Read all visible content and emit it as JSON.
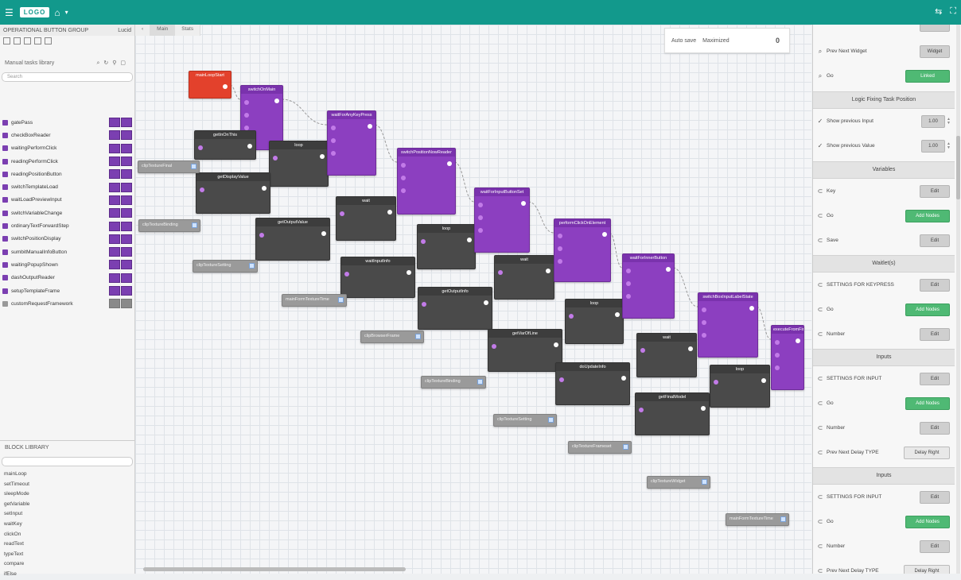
{
  "topbar": {
    "brand": "LOGO",
    "menu_icon": "menu-icon",
    "home_icon": "home-icon"
  },
  "left": {
    "header": "OPERATIONAL BUTTON GROUP",
    "header_right": "Lucid",
    "section": "Manual tasks library",
    "search_placeholder": "Search",
    "items": [
      {
        "label": "gatePass"
      },
      {
        "label": "checkBoxReader"
      },
      {
        "label": "waitingPerformClick"
      },
      {
        "label": "readingPerformClick"
      },
      {
        "label": "readingPositionButton"
      },
      {
        "label": "switchTemplateLoad"
      },
      {
        "label": "waitLoadPreviewInput"
      },
      {
        "label": "switchVariableChange"
      },
      {
        "label": "ordinaryTextForwardStep"
      },
      {
        "label": "switchPositionDisplay"
      },
      {
        "label": "sumbitManualInfoButton"
      },
      {
        "label": "waitingPopupShown"
      },
      {
        "label": "dashOutputReader"
      },
      {
        "label": "setupTemplateFrame"
      },
      {
        "label": "customRequestFramework"
      }
    ],
    "library_title": "BLOCK LIBRARY",
    "library_search": "",
    "library": [
      "mainLoop",
      "setTimeout",
      "sleepMode",
      "getVariable",
      "setInput",
      "waitKey",
      "clickOn",
      "readText",
      "typeText",
      "compare",
      "ifElse"
    ]
  },
  "canvas": {
    "tabs": [
      "‹",
      "Main",
      "Stats"
    ],
    "info": {
      "a": "Auto save",
      "b": "Maximized",
      "count": "0"
    },
    "nodes": [
      {
        "title": "mainLoopStart",
        "c": "red"
      },
      {
        "title": "switchOnMain",
        "c": "purple"
      },
      {
        "title": "getInOnThis",
        "c": "dark"
      },
      {
        "title": "loop",
        "c": "dark"
      },
      {
        "title": "waitForAnyKeyPress",
        "c": "purple"
      },
      {
        "title": "getDisplayValue",
        "c": "dark"
      },
      {
        "title": "wait",
        "c": "dark"
      },
      {
        "title": "switchPositionNowReader",
        "c": "purple"
      },
      {
        "title": "getOutputValue",
        "c": "dark"
      },
      {
        "title": "loop",
        "c": "dark"
      },
      {
        "title": "waitForInputButtonSet",
        "c": "purple"
      },
      {
        "title": "waitInputInfo",
        "c": "dark"
      },
      {
        "title": "wait",
        "c": "dark"
      },
      {
        "title": "performClickOnElement",
        "c": "purple"
      },
      {
        "title": "getOutputInfo",
        "c": "dark"
      },
      {
        "title": "loop",
        "c": "dark"
      },
      {
        "title": "waitForInnerButton",
        "c": "purple"
      },
      {
        "title": "getVarOfLine",
        "c": "dark"
      },
      {
        "title": "wait",
        "c": "dark"
      },
      {
        "title": "switchBoxInputLabelState",
        "c": "purple"
      },
      {
        "title": "doUpdateInfo",
        "c": "dark"
      },
      {
        "title": "loop",
        "c": "dark"
      },
      {
        "title": "executeFromFinal",
        "c": "purple"
      },
      {
        "title": "getFinalModel",
        "c": "dark"
      }
    ],
    "gray_nodes": [
      "clipTextureFinal",
      "clipTextureBinding",
      "clipTextureSetting",
      "mainFormTextureTime",
      "clipBrowserFrame",
      "clipTextureBinding",
      "clipTextureSetting",
      "clipTextureFrameset",
      "clipTextureWidget",
      "mainFormTextureTime"
    ]
  },
  "right": {
    "rows_top": [
      {
        "label": "Prev Next Widget",
        "btn": "Widget",
        "style": "grey",
        "icon": "search-icon"
      },
      {
        "label": "Go",
        "btn": "Linked",
        "style": "green",
        "icon": "search-icon"
      }
    ],
    "sec1": "Logic Fixing Task Position",
    "rows_sec1": [
      {
        "label": "Show previous Input",
        "val": "1.00"
      },
      {
        "label": "Show previous Value",
        "val": "1.00"
      }
    ],
    "sec2": "Variables",
    "rows_sec2": [
      {
        "label": "Key",
        "btn": "Edit",
        "style": "grey"
      },
      {
        "label": "Go",
        "btn": "Add Nodes",
        "style": "green"
      },
      {
        "label": "Save",
        "btn": "Edit",
        "style": "grey"
      }
    ],
    "sec3": "Waitlet(s)",
    "rows_sec3": [
      {
        "label": "SETTINGS FOR KEYPRESS",
        "btn": "Edit",
        "style": "grey"
      },
      {
        "label": "Go",
        "btn": "Add Nodes",
        "style": "green"
      },
      {
        "label": "Number",
        "btn": "Edit",
        "style": "grey"
      }
    ],
    "sec4": "Inputs",
    "rows_sec4": [
      {
        "label": "SETTINGS FOR INPUT",
        "btn": "Edit",
        "style": "grey"
      },
      {
        "label": "Go",
        "btn": "Add Nodes",
        "style": "green"
      },
      {
        "label": "Number",
        "btn": "Edit",
        "style": "grey"
      },
      {
        "label": "Prev Next Delay TYPE",
        "btn": "Delay Right",
        "style": "white"
      }
    ],
    "sec5": "Inputs",
    "rows_sec5": [
      {
        "label": "SETTINGS FOR INPUT",
        "btn": "Edit",
        "style": "grey"
      },
      {
        "label": "Go",
        "btn": "Add Nodes",
        "style": "green"
      },
      {
        "label": "Number",
        "btn": "Edit",
        "style": "grey"
      },
      {
        "label": "Prev Next Delay TYPE",
        "btn": "Delay Right",
        "style": "white"
      }
    ]
  },
  "colors": {
    "topbar": "#12998c",
    "purple": "#8c3fc0",
    "dark": "#4a4a4a",
    "red": "#e3412c",
    "green": "#4fb974"
  }
}
